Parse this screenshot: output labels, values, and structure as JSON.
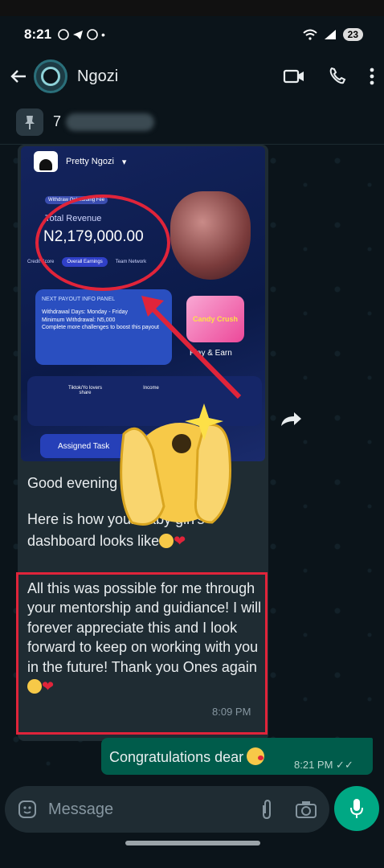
{
  "status_bar": {
    "time": "8:21",
    "battery": "23"
  },
  "header": {
    "contact_name": "Ngozi"
  },
  "pinned": {
    "text": "7"
  },
  "screenshot": {
    "user": "Pretty Ngozi",
    "tag": "Withdraw Onboarding Fee",
    "revenue_label": "Total Revenue",
    "revenue_amount": "N2,179,000.00",
    "tabs": [
      "Credit Score",
      "Overall Earnings",
      "Team Network"
    ],
    "panel_title": "NEXT PAYOUT INFO PANEL",
    "panel_lines": [
      "Withdrawal Days: Monday - Friday",
      "Minimum Withdrawal: N5,000",
      "Complete more challenges to boost this payout"
    ],
    "candy_label": "Candy Crush",
    "play_label": "Play & Earn",
    "row_items": [
      "Tiktok/Yo lovers share",
      "Income"
    ],
    "assigned": "Assigned Task"
  },
  "messages": {
    "incoming_greeting": "Good evening",
    "incoming_line2": "Here is how your baby girl's",
    "incoming_line3": "dashboard looks like",
    "incoming_highlight": "All this was possible for me through your mentorship and guidiance! I will forever appreciate this and I look forward to keep on working with you in the future! Thank you Ones again",
    "incoming_time": "8:09 PM",
    "outgoing_text": "Congratulations dear",
    "outgoing_time": "8:21 PM"
  },
  "composer": {
    "placeholder": "Message"
  },
  "colors": {
    "accent": "#00a884",
    "outgoing_bubble": "#005c4b",
    "annotation_red": "#e0243a"
  }
}
